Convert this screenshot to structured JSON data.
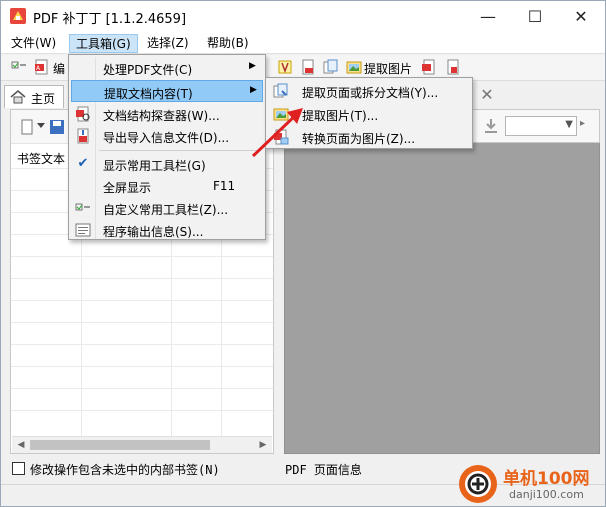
{
  "window": {
    "title": "PDF 补丁丁 [1.1.2.4659]",
    "minimize_glyph": "—",
    "maximize_glyph": "☐",
    "close_glyph": "✕",
    "icon": "pdf-patcher-app-icon"
  },
  "menubar": {
    "items": [
      {
        "label": "文件(W)"
      },
      {
        "label": "工具箱(G)",
        "active": true
      },
      {
        "label": "选择(Z)"
      },
      {
        "label": "帮助(B)"
      }
    ]
  },
  "toolbar": {
    "partial_label": "编",
    "extract_images_label": "提取图片"
  },
  "tabs": {
    "home_label": "主页",
    "close_glyph": "✕"
  },
  "left_panel": {
    "column_header": "书签文本"
  },
  "dropdown": {
    "items": [
      {
        "label": "处理PDF文件(C)",
        "has_submenu": true
      },
      {
        "label": "提取文档内容(T)",
        "has_submenu": true,
        "active": true
      },
      {
        "label": "文档结构探查器(W)..."
      },
      {
        "label": "导出导入信息文件(D)..."
      },
      {
        "label": "显示常用工具栏(G)",
        "checked": true
      },
      {
        "label": "全屏显示",
        "shortcut": "F11"
      },
      {
        "label": "自定义常用工具栏(Z)..."
      },
      {
        "label": "程序输出信息(S)..."
      }
    ]
  },
  "submenu": {
    "items": [
      {
        "label": "提取页面或拆分文档(Y)..."
      },
      {
        "label": "提取图片(T)..."
      },
      {
        "label": "转换页面为图片(Z)..."
      }
    ]
  },
  "footer": {
    "checkbox_label": "修改操作包含未选中的内部书签(N)",
    "page_info_label": "PDF 页面信息"
  },
  "watermark": {
    "brand": "单机100网",
    "domain": "danji100.com"
  },
  "colors": {
    "menu_highlight": "#91c9f7",
    "annotation_red": "#e02020",
    "watermark_orange": "#e8641a"
  }
}
